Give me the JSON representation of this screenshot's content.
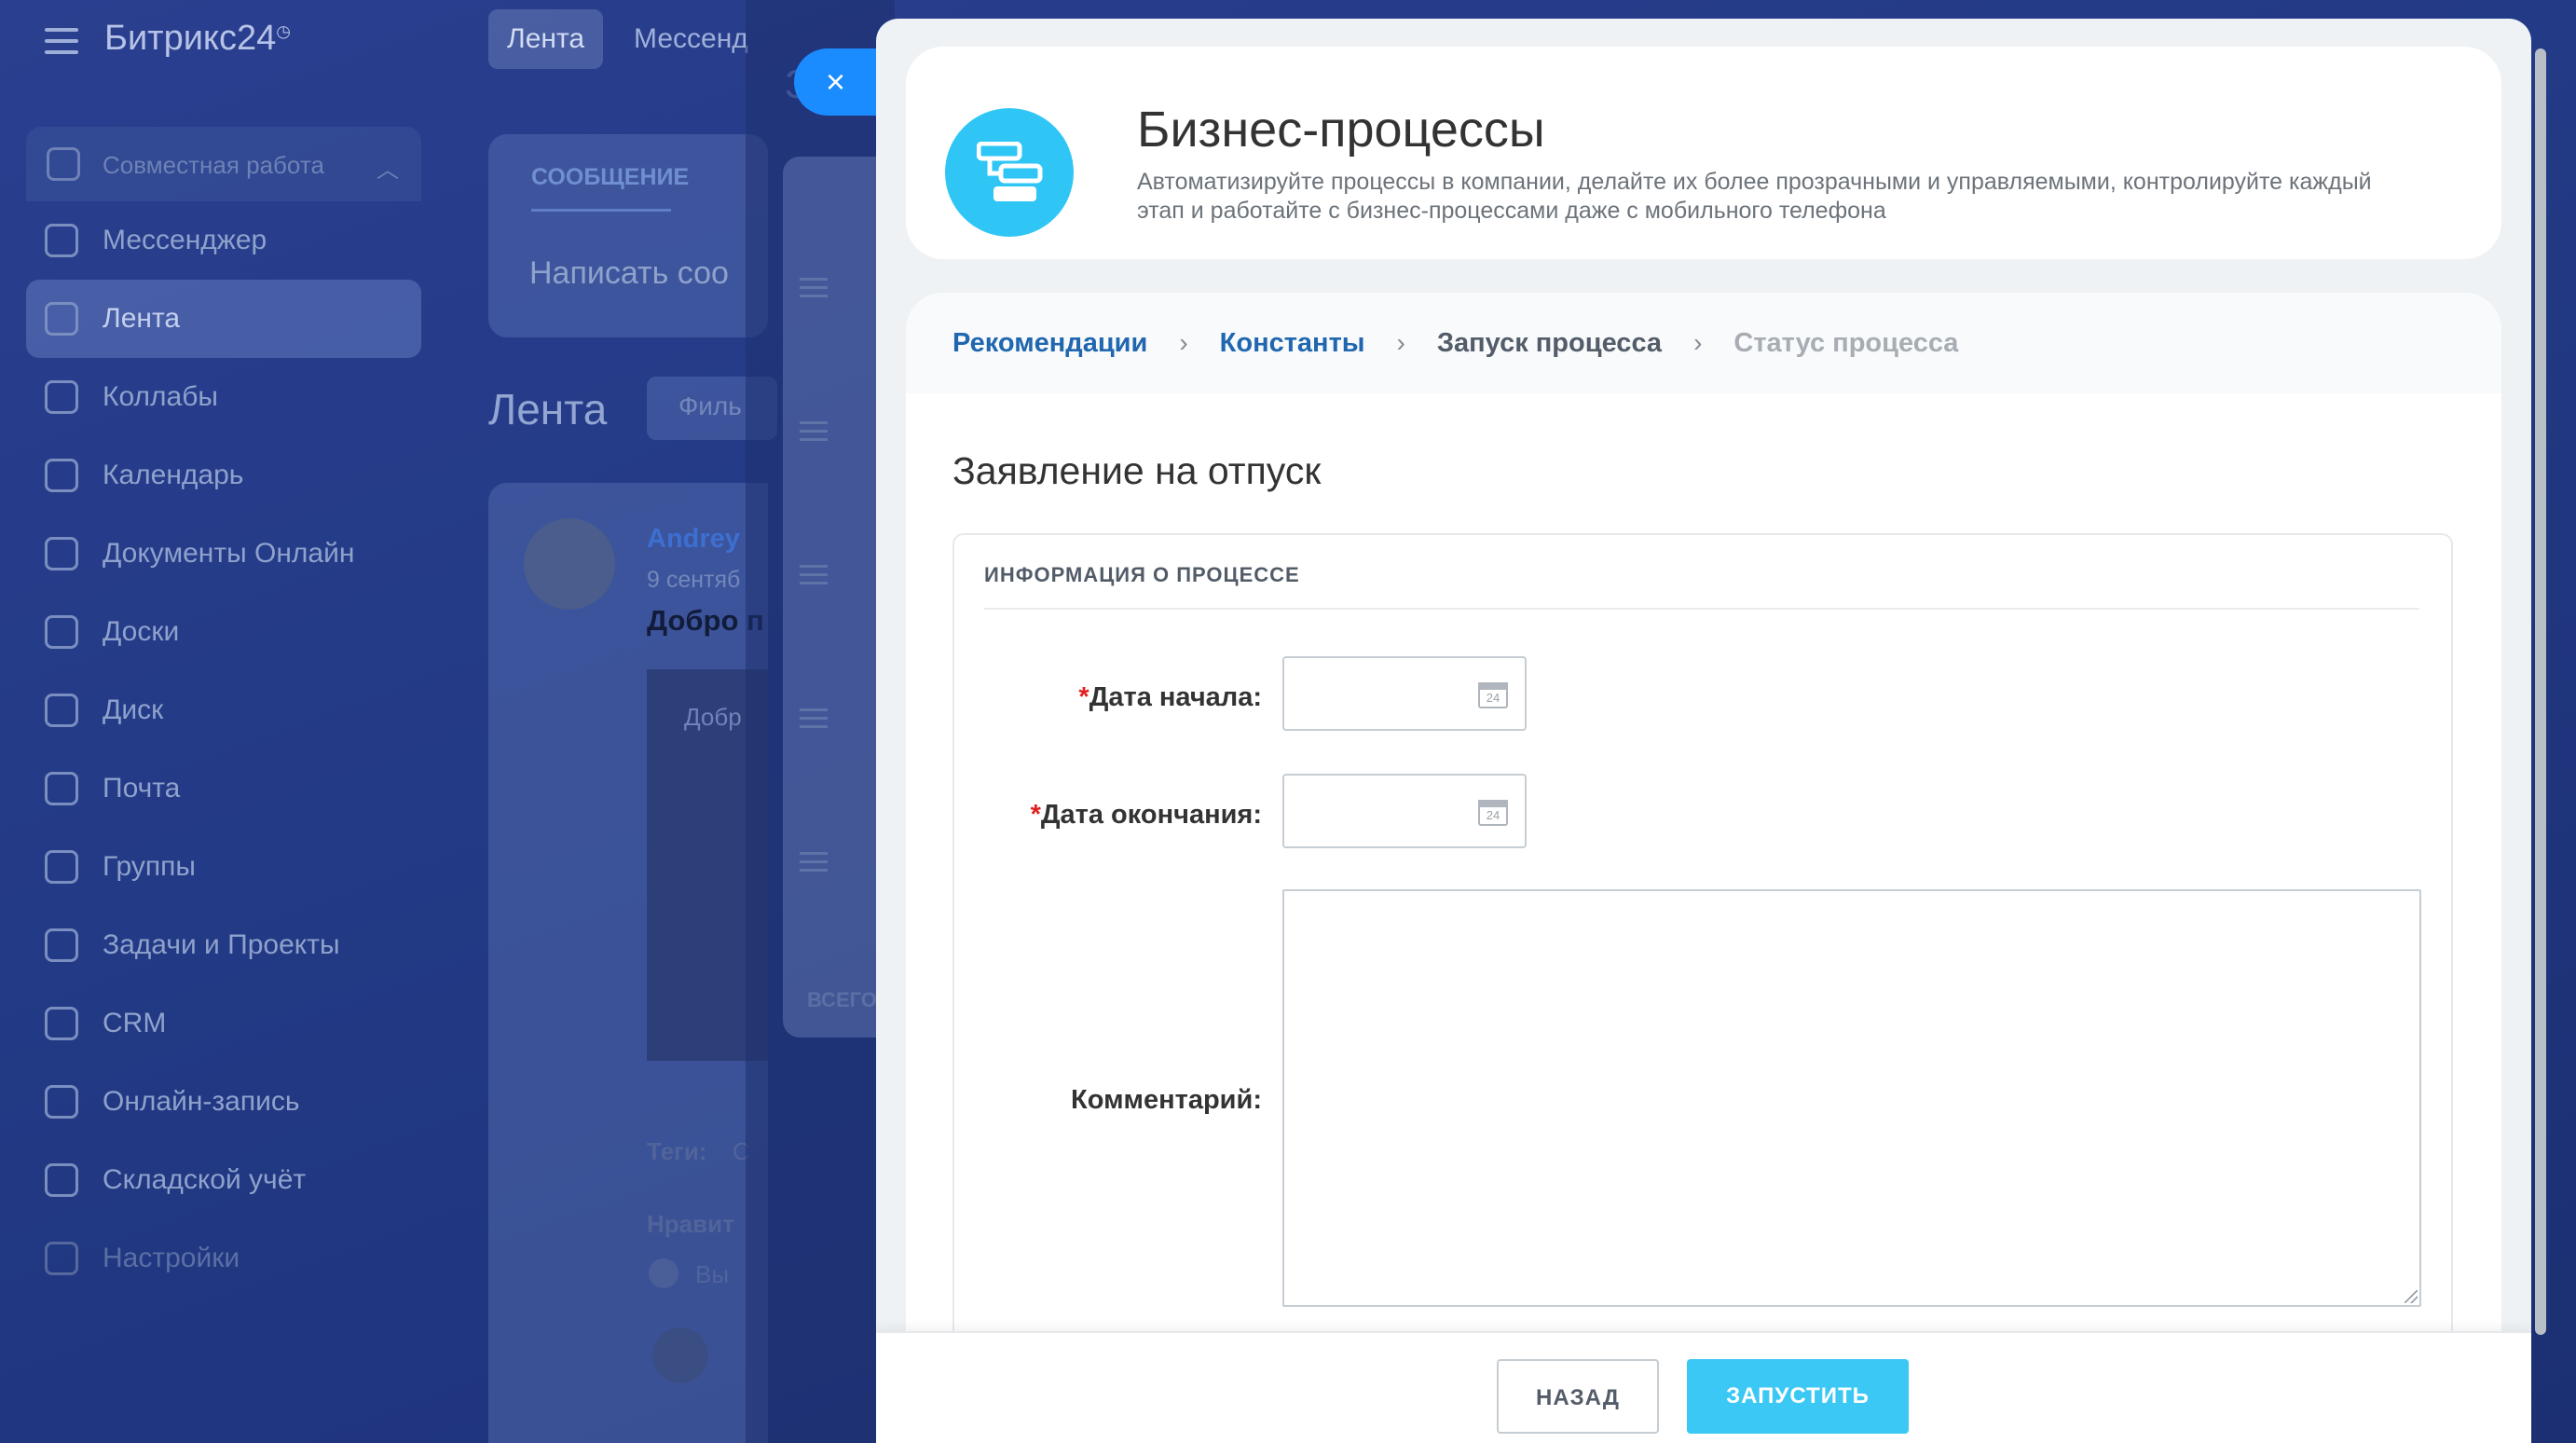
{
  "app": {
    "logo": "Битрикс24",
    "top_tabs": [
      "Лента",
      "Мессенд"
    ],
    "sidebar": {
      "group_label": "Совместная работа",
      "items": [
        {
          "label": "Мессенджер"
        },
        {
          "label": "Лента"
        },
        {
          "label": "Коллабы"
        },
        {
          "label": "Календарь"
        },
        {
          "label": "Документы Онлайн"
        },
        {
          "label": "Доски"
        },
        {
          "label": "Диск"
        },
        {
          "label": "Почта"
        },
        {
          "label": "Группы"
        },
        {
          "label": "Задачи и Проекты"
        },
        {
          "label": "CRM"
        },
        {
          "label": "Онлайн-запись"
        },
        {
          "label": "Складской учёт"
        }
      ],
      "faded_item": "Настройки"
    },
    "feed": {
      "composer_tab": "СООБЩЕНИЕ",
      "composer_placeholder": "Написать соо",
      "title": "Лента",
      "filter": "Филь",
      "post_author": "Andrey",
      "post_date": "9 сентяб",
      "post_title": "Добро п",
      "post_image_text": "Добр",
      "tags_label": "Теги:",
      "tags_value": "C",
      "likes_label": "Нравит",
      "likes_value": "Вы"
    },
    "middle_panel": {
      "footer_text": "ВСЕГО",
      "title_char": "З"
    }
  },
  "slider": {
    "header": {
      "title": "Бизнес-процессы",
      "description": "Автоматизируйте процессы в компании, делайте их более прозрачными и управляемыми, контролируйте каждый этап и работайте с бизнес-процессами даже с мобильного телефона"
    },
    "breadcrumbs": [
      {
        "label": "Рекомендации",
        "state": "link"
      },
      {
        "label": "Константы",
        "state": "link"
      },
      {
        "label": "Запуск процесса",
        "state": "current"
      },
      {
        "label": "Статус процесса",
        "state": "muted"
      }
    ],
    "breadcrumb_separator": "›",
    "form_title": "Заявление на отпуск",
    "section_label": "ИНФОРМАЦИЯ О ПРОЦЕССЕ",
    "fields": {
      "start_date": {
        "label": "Дата начала:",
        "required_mark": "*",
        "value": "",
        "calendar_day": "24"
      },
      "end_date": {
        "label": "Дата окончания:",
        "required_mark": "*",
        "value": "",
        "calendar_day": "24"
      },
      "comment": {
        "label": "Комментарий:",
        "value": ""
      }
    },
    "buttons": {
      "back": "НАЗАД",
      "run": "ЗАПУСТИТЬ"
    },
    "close_icon": "×"
  },
  "colors": {
    "accent_link": "#2067b0",
    "run_button": "#3bc8f5",
    "logo_circle": "#2fc6f6",
    "close_button": "#1a8cff",
    "required": "#e02020"
  }
}
